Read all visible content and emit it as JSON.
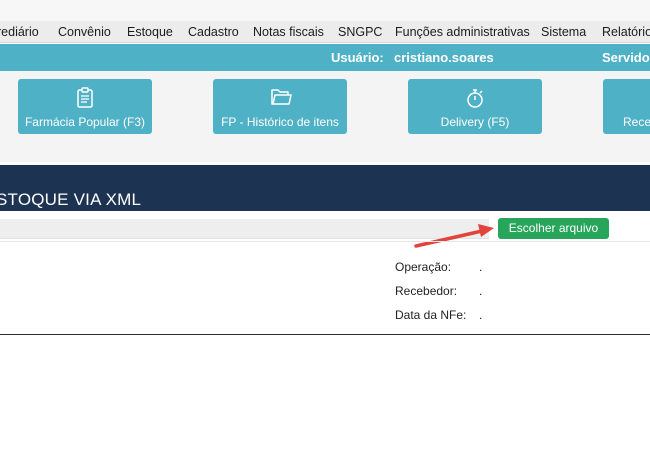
{
  "menu": {
    "items": [
      "rediário",
      "Convênio",
      "Estoque",
      "Cadastro",
      "Notas fiscais",
      "SNGPC",
      "Funções administrativas",
      "Sistema",
      "Relatórios"
    ]
  },
  "userbar": {
    "user_label": "Usuário:",
    "user_value": "cristiano.soares",
    "server_label": "Servidor"
  },
  "shortcuts": [
    {
      "label": "Farmácia Popular (F3)",
      "icon": "clipboard-icon"
    },
    {
      "label": "FP - Histórico de itens",
      "icon": "folder-icon"
    },
    {
      "label": "Delivery (F5)",
      "icon": "stopwatch-icon"
    },
    {
      "label": "Receb",
      "icon": ""
    }
  ],
  "page": {
    "title": "STOQUE VIA XML"
  },
  "import": {
    "choose_file_label": "Escolher arquivo"
  },
  "info": [
    {
      "label": "Operação:",
      "value": "."
    },
    {
      "label": "Recebedor:",
      "value": "."
    },
    {
      "label": "Data da NFe:",
      "value": "."
    }
  ],
  "colors": {
    "accent": "#4fb1c6",
    "header": "#1c3352",
    "choose_button": "#27a55a",
    "annotation_arrow": "#e0443c"
  }
}
